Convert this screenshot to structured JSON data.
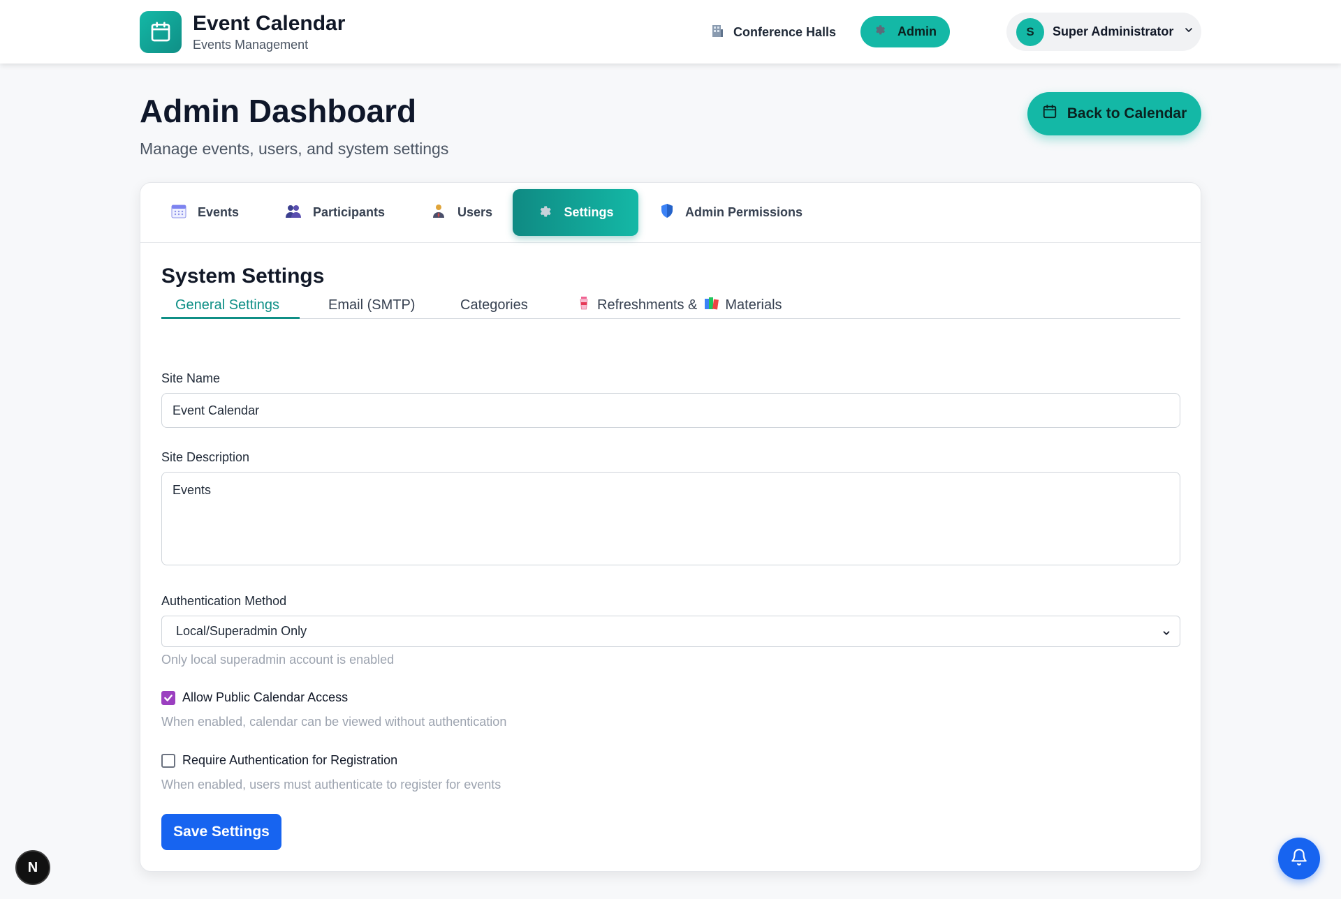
{
  "header": {
    "app_title": "Event Calendar",
    "app_subtitle": "Events Management",
    "nav": {
      "conference_halls": "Conference Halls",
      "admin": "Admin"
    },
    "user": {
      "initial": "S",
      "name": "Super Administrator"
    }
  },
  "page": {
    "title": "Admin Dashboard",
    "subtitle": "Manage events, users, and system settings",
    "back_button": "Back to Calendar"
  },
  "tabs": {
    "events": "Events",
    "participants": "Participants",
    "users": "Users",
    "settings": "Settings",
    "admin_permissions": "Admin Permissions"
  },
  "settings": {
    "title": "System Settings",
    "subtabs": {
      "general": "General Settings",
      "email": "Email (SMTP)",
      "categories": "Categories",
      "refreshments_prefix": "Refreshments &",
      "materials": "Materials"
    },
    "site_name": {
      "label": "Site Name",
      "value": "Event Calendar"
    },
    "site_description": {
      "label": "Site Description",
      "value": "Events"
    },
    "auth_method": {
      "label": "Authentication Method",
      "selected": "Local/Superadmin Only",
      "hint": "Only local superadmin account is enabled"
    },
    "public_access": {
      "label": "Allow Public Calendar Access",
      "checked": true,
      "hint": "When enabled, calendar can be viewed without authentication"
    },
    "require_auth": {
      "label": "Require Authentication for Registration",
      "checked": false,
      "hint": "When enabled, users must authenticate to register for events"
    },
    "save_button": "Save Settings"
  },
  "floating": {
    "framework_badge": "N"
  },
  "colors": {
    "accent": "#14b8a6",
    "accent_dark": "#0f8f86",
    "primary_button": "#1764f0",
    "checkbox": "#9b3fc0"
  }
}
